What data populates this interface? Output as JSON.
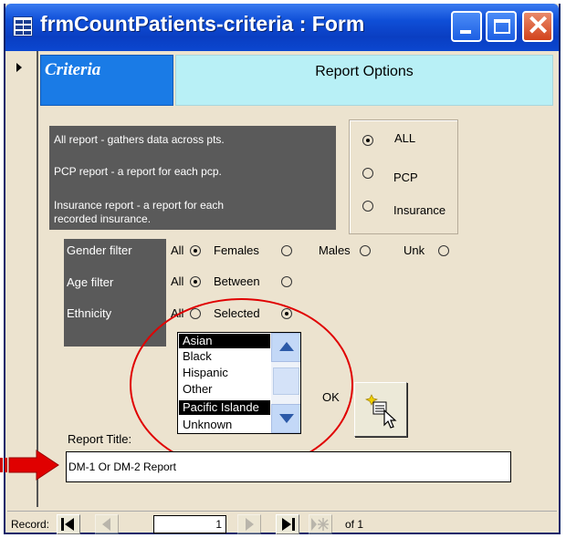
{
  "window": {
    "title": "frmCountPatients-criteria : Form"
  },
  "tabs": {
    "criteria": "Criteria",
    "report_options": "Report Options"
  },
  "description": {
    "all": "All report - gathers data across pts.",
    "pcp": "PCP report - a report for each pcp.",
    "insurance_1": "Insurance report  - a report for each",
    "insurance_2": "recorded insurance."
  },
  "report_type": {
    "selected": "ALL",
    "options": [
      "ALL",
      "PCP",
      "Insurance"
    ]
  },
  "filters": {
    "gender_label": "Gender filter",
    "age_label": "Age filter",
    "ethnicity_label": "Ethnicity",
    "gender_options": [
      "All",
      "Females",
      "Males",
      "Unk"
    ],
    "gender_selected": "All",
    "age_options": [
      "All",
      "Between"
    ],
    "age_selected": "All",
    "ethnicity_options": [
      "All",
      "Selected"
    ],
    "ethnicity_selected": "Selected"
  },
  "ethnicity_list": {
    "items": [
      "Asian",
      "Black",
      "Hispanic",
      "Other",
      "Pacific Islande",
      "Unknown"
    ],
    "selected": [
      "Asian",
      "Pacific Islande"
    ]
  },
  "ok_label": "OK",
  "report_title": {
    "label": "Report Title:",
    "value": "DM-1 Or DM-2 Report"
  },
  "navigation": {
    "record_label": "Record:",
    "current": "1",
    "of_label": "of 1"
  },
  "colors": {
    "titlebar": "#0a3ec2",
    "criteria_tab": "#1a7be6",
    "report_options_tab": "#b8f0f6",
    "panel_dark": "#5a5a5a",
    "form_background": "#ece3cf",
    "annotation_red": "#e00000"
  }
}
